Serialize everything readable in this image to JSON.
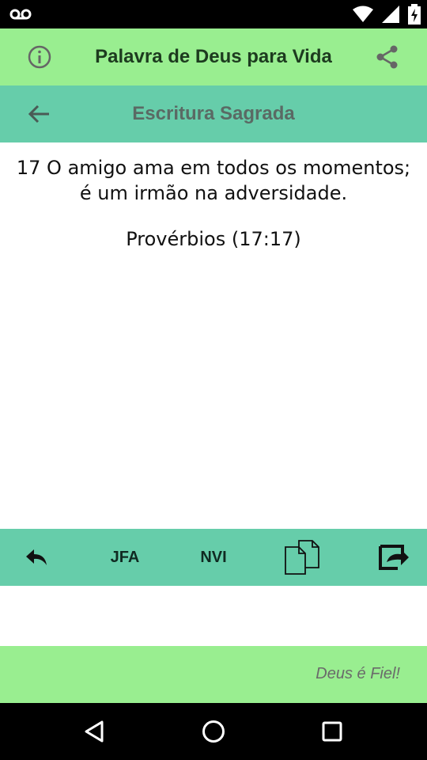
{
  "app": {
    "title": "Palavra de Deus para Vida",
    "icons": {
      "info": "info-icon",
      "share": "share-icon"
    }
  },
  "subheader": {
    "title": "Escritura Sagrada",
    "icons": {
      "back": "back-arrow-icon"
    }
  },
  "verse": {
    "line1": "17 O amigo ama em todos os momentos;",
    "line2": "é um irmão na adversidade.",
    "reference": "Provérbios (17:17)"
  },
  "toolbar": {
    "reply_icon": "reply-icon",
    "version1": "JFA",
    "version2": "NVI",
    "copy_icon": "copy-icon",
    "share_icon": "forward-share-icon"
  },
  "footer": {
    "text": "Deus é Fiel!"
  },
  "colors": {
    "appbar": "#99ee90",
    "subbar": "#66cdaa",
    "footer": "#99ee90"
  }
}
